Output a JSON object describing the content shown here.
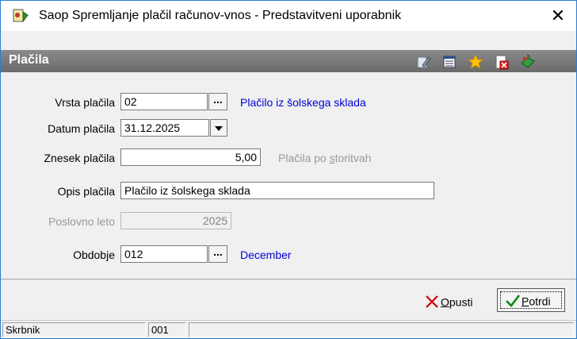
{
  "window": {
    "title": "Saop Spremljanje plačil računov-vnos - Predstavitveni uporabnik",
    "close_glyph": "✕"
  },
  "header": {
    "title": "Plačila",
    "toolbar_icons": [
      "edit-icon",
      "list-icon",
      "star-icon",
      "delete-document-icon",
      "exit-book-icon"
    ]
  },
  "form": {
    "vrsta_placila": {
      "label": "Vrsta plačila",
      "value": "02",
      "button": "...",
      "description": "Plačilo iz šolskega sklada"
    },
    "datum_placila": {
      "label": "Datum plačila",
      "value": "31.12.2025"
    },
    "znesek_placila": {
      "label": "Znesek plačila",
      "value": "5,00",
      "note_before": "Plačila po ",
      "note_underlined": "s",
      "note_after": "toritvah"
    },
    "opis_placila": {
      "label": "Opis plačila",
      "value": "Plačilo iz šolskega sklada"
    },
    "poslovno_leto": {
      "label": "Poslovno leto",
      "value": "2025"
    },
    "obdobje": {
      "label": "Obdobje",
      "value": "012",
      "button": "...",
      "description": "December"
    }
  },
  "buttons": {
    "cancel": {
      "mnemonic": "O",
      "rest": "pusti"
    },
    "confirm": {
      "mnemonic": "P",
      "rest": "otrdi"
    }
  },
  "status_bar": {
    "label": "Skrbnik",
    "value": "001",
    "extra": ""
  },
  "colors": {
    "accent_blue": "#0000d8",
    "header_gray": "#7a7a7a",
    "cancel_red": "#cc0000",
    "confirm_green": "#118811"
  }
}
